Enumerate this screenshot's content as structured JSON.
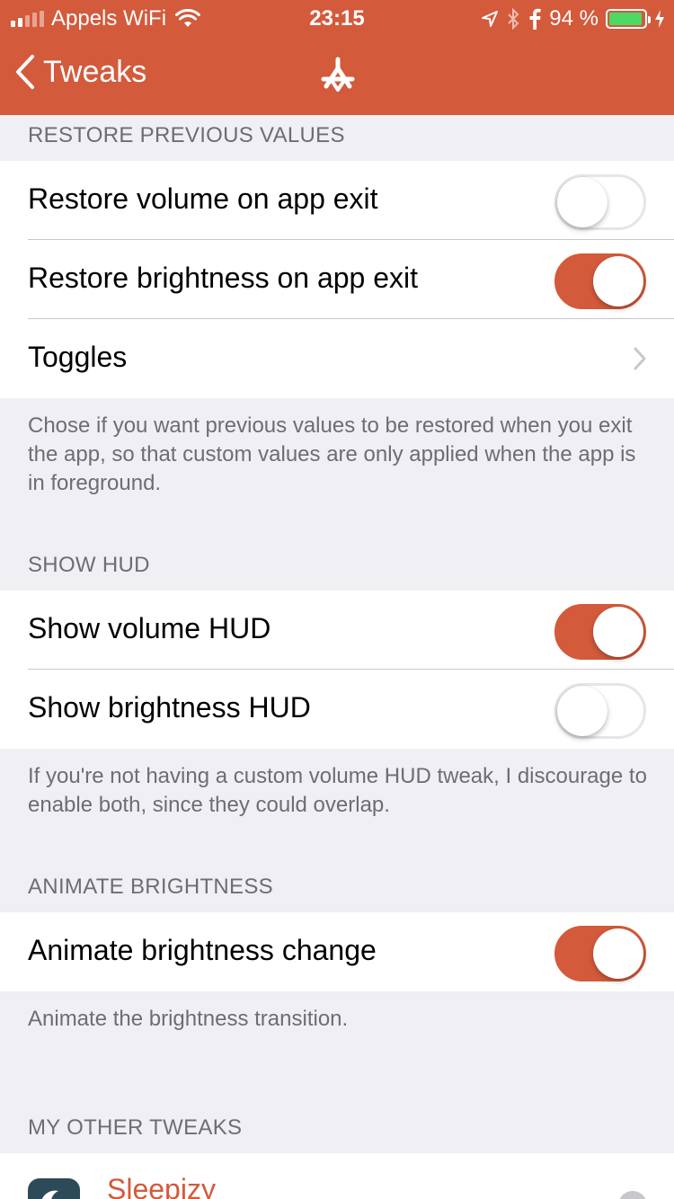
{
  "status_bar": {
    "carrier": "Appels WiFi",
    "time": "23:15",
    "battery_percent": "94 %",
    "battery_level": 0.94
  },
  "nav": {
    "back_label": "Tweaks"
  },
  "sections": {
    "restore": {
      "header": "RESTORE PREVIOUS VALUES",
      "rows": [
        {
          "label": "Restore volume on app exit",
          "toggle_on": false
        },
        {
          "label": "Restore brightness on app exit",
          "toggle_on": true
        },
        {
          "label": "Toggles"
        }
      ],
      "footer": "Chose if you want previous values to be restored when you exit the app, so that custom values are only applied when the app is in foreground."
    },
    "hud": {
      "header": "SHOW HUD",
      "rows": [
        {
          "label": "Show volume HUD",
          "toggle_on": true
        },
        {
          "label": "Show brightness HUD",
          "toggle_on": false
        }
      ],
      "footer": "If you're not having a custom volume HUD tweak, I discourage to enable both, since they could overlap."
    },
    "animate": {
      "header": "ANIMATE BRIGHTNESS",
      "rows": [
        {
          "label": "Animate brightness change",
          "toggle_on": true
        }
      ],
      "footer": "Animate the brightness transition."
    },
    "other": {
      "header": "MY OTHER TWEAKS",
      "apps": [
        {
          "name": "Sleepizy"
        }
      ]
    }
  },
  "colors": {
    "accent": "#d35a3b",
    "background": "#efeff4",
    "battery": "#4cd964"
  }
}
